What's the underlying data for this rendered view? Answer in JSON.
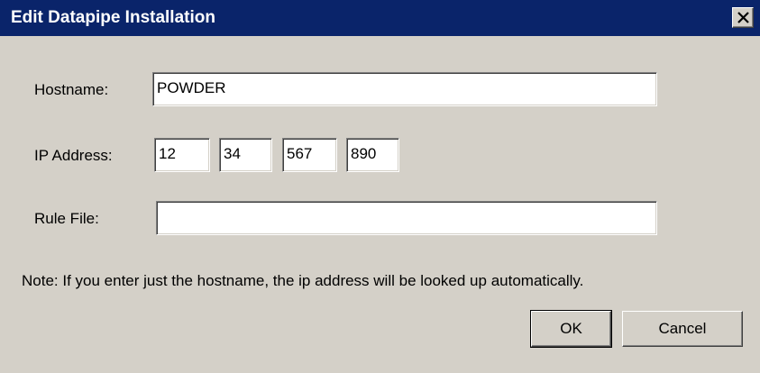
{
  "window": {
    "title": "Edit Datapipe Installation",
    "close_icon": "close-icon"
  },
  "form": {
    "hostname_label": "Hostname:",
    "hostname_value": "POWDER",
    "ip_label": "IP Address:",
    "ip_octets": [
      "12",
      "34",
      "567",
      "890"
    ],
    "rule_file_label": "Rule File:",
    "rule_file_value": ""
  },
  "note": "Note: If you enter just the hostname, the ip address will be looked up automatically.",
  "buttons": {
    "ok_label": "OK",
    "cancel_label": "Cancel"
  },
  "colors": {
    "titlebar": "#0a246a",
    "dialog_face": "#d4d0c8",
    "field_background": "#ffffff"
  }
}
